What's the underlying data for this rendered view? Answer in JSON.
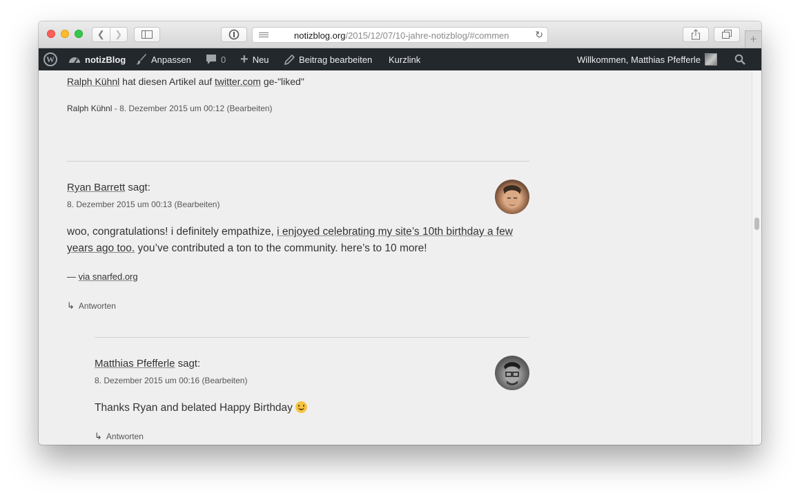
{
  "browser": {
    "url_host": "notizblog.org",
    "url_path": "/2015/12/07/10-jahre-notizblog/#commen",
    "new_tab_label": "+"
  },
  "adminbar": {
    "site_name": "notizBlog",
    "customize": "Anpassen",
    "comments_count": "0",
    "new": "Neu",
    "edit_post": "Beitrag bearbeiten",
    "shortlink": "Kurzlink",
    "welcome": "Willkommen, Matthias Pfefferle"
  },
  "like": {
    "author": "Ralph Kühnl",
    "text_mid": "hat diesen Artikel auf",
    "service": "twitter.com",
    "text_end": "ge-\"liked\"",
    "meta_author": "Ralph Kühnl",
    "meta_date": "- 8. Dezember 2015 um 00:12",
    "meta_edit": "(Bearbeiten)"
  },
  "comment1": {
    "author": "Ryan Barrett",
    "says": "sagt:",
    "date": "8. Dezember 2015 um 00:13",
    "edit": "(Bearbeiten)",
    "body_start": "woo, congratulations! i definitely empathize,",
    "body_link_1": "i enjoyed celebrating my site’s 10th birthday a few",
    "body_link_2": "years ago too.",
    "body_end": "you’ve contributed a ton to the community. here’s to 10 more!",
    "via_prefix": "—",
    "via_link": "via snarfed.org",
    "reply": "Antworten"
  },
  "comment2": {
    "author": "Matthias Pfefferle",
    "says": "sagt:",
    "date": "8. Dezember 2015 um 00:16",
    "edit": "(Bearbeiten)",
    "body": "Thanks Ryan and belated Happy Birthday",
    "reply": "Antworten"
  }
}
